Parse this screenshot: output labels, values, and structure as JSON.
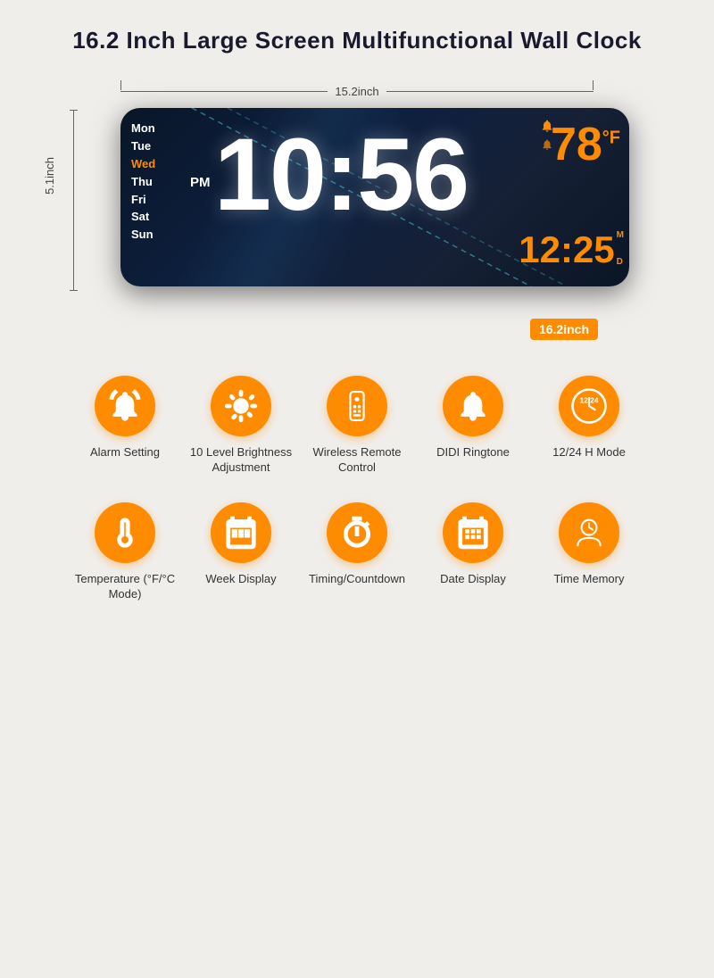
{
  "title": "16.2 Inch Large Screen Multifunctional Wall Clock",
  "clock": {
    "days": [
      "Mon",
      "Tue",
      "Wed",
      "Thu",
      "Fri",
      "Sat",
      "Sun"
    ],
    "active_day": "Wed",
    "period": "PM",
    "time": "10:56",
    "temperature": "78",
    "temp_unit": "°F",
    "date_display": "12:25",
    "date_m": "M",
    "date_d": "D",
    "size_badge": "16.2inch",
    "dim_width": "15.2inch",
    "dim_height": "5.1inch"
  },
  "features_row1": [
    {
      "id": "alarm",
      "label": "Alarm Setting",
      "icon": "alarm"
    },
    {
      "id": "brightness",
      "label": "10 Level Brightness Adjustment",
      "icon": "brightness"
    },
    {
      "id": "remote",
      "label": "Wireless Remote Control",
      "icon": "remote"
    },
    {
      "id": "ringtone",
      "label": "DIDI Ringtone",
      "icon": "bell"
    },
    {
      "id": "mode",
      "label": "12/24 H Mode",
      "icon": "clock24"
    }
  ],
  "features_row2": [
    {
      "id": "temperature",
      "label": "Temperature (°F/°C  Mode)",
      "icon": "thermometer"
    },
    {
      "id": "week",
      "label": "Week Display",
      "icon": "calendar-week"
    },
    {
      "id": "countdown",
      "label": "Timing/Countdown",
      "icon": "stopwatch"
    },
    {
      "id": "date",
      "label": "Date Display",
      "icon": "calendar-date"
    },
    {
      "id": "memory",
      "label": "Time Memory",
      "icon": "brain-clock"
    }
  ]
}
